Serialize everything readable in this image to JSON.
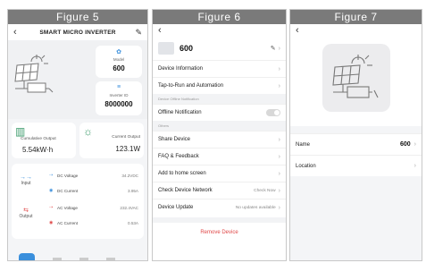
{
  "figures": {
    "f5": "Figure 5",
    "f6": "Figure 6",
    "f7": "Figure 7"
  },
  "fig5": {
    "header_title": "SMART MICRO INVERTER",
    "model_label": "Model",
    "model_value": "600",
    "inverter_id_label": "Inverter ID",
    "inverter_id_value": "8000000",
    "cumulative_label": "Cumulative Output",
    "cumulative_value": "5.54kW·h",
    "current_label": "Current Output",
    "current_value": "123.1W",
    "input_label": "Input",
    "output_label": "Output",
    "rows": [
      {
        "label": "DC Voltage",
        "value": "34.2VDC"
      },
      {
        "label": "DC Current",
        "value": "3.95A"
      },
      {
        "label": "AC Voltage",
        "value": "232.4VAC"
      },
      {
        "label": "AC Current",
        "value": "0.53A"
      }
    ]
  },
  "fig6": {
    "device_name": "600",
    "items_top": [
      {
        "label": "Device Information"
      },
      {
        "label": "Tap-to-Run and Automation"
      }
    ],
    "section_offline": "Device Offline Notification",
    "offline_label": "Offline Notification",
    "section_others": "Others",
    "items_bottom": [
      {
        "label": "Share Device",
        "value": ""
      },
      {
        "label": "FAQ & Feedback",
        "value": ""
      },
      {
        "label": "Add to home screen",
        "value": ""
      },
      {
        "label": "Check Device Network",
        "value": "Check Now"
      },
      {
        "label": "Device Update",
        "value": "No updates available"
      }
    ],
    "remove_label": "Remove Device"
  },
  "fig7": {
    "name_label": "Name",
    "name_value": "600",
    "location_label": "Location"
  }
}
